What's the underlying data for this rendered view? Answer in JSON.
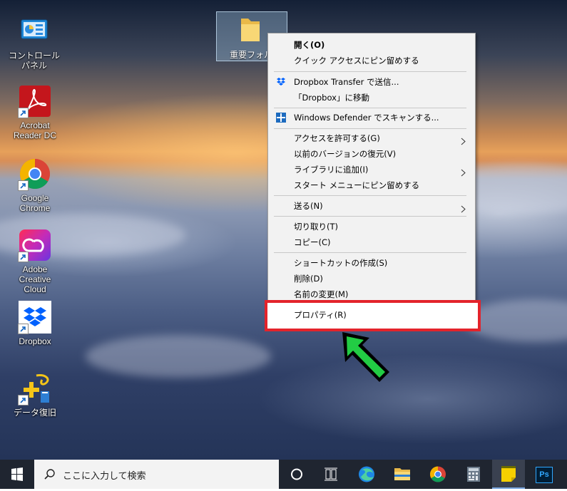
{
  "desktop": {
    "icons": [
      {
        "label": "コントロール パネル",
        "icon": "control-panel-icon"
      },
      {
        "label": "Acrobat Reader DC",
        "icon": "acrobat-reader-icon"
      },
      {
        "label": "Google Chrome",
        "icon": "chrome-icon"
      },
      {
        "label": "Adobe Creative Cloud",
        "icon": "creative-cloud-icon"
      },
      {
        "label": "Dropbox",
        "icon": "dropbox-icon"
      },
      {
        "label": "データ復旧",
        "icon": "data-recovery-icon"
      }
    ],
    "selected_folder": {
      "label": "重要フォルダ",
      "icon": "folder-icon"
    }
  },
  "context_menu": {
    "items": [
      {
        "label": "開く(O)",
        "bold": true
      },
      {
        "label": "クイック アクセスにピン留めする"
      },
      {
        "label": "Dropbox Transfer で送信...",
        "icon": "dropbox-icon"
      },
      {
        "label": "「Dropbox」に移動"
      },
      {
        "label": "Windows Defender でスキャンする...",
        "icon": "defender-icon"
      },
      {
        "label": "アクセスを許可する(G)",
        "submenu": true
      },
      {
        "label": "以前のバージョンの復元(V)"
      },
      {
        "label": "ライブラリに追加(I)",
        "submenu": true
      },
      {
        "label": "スタート メニューにピン留めする"
      },
      {
        "label": "送る(N)",
        "submenu": true
      },
      {
        "label": "切り取り(T)"
      },
      {
        "label": "コピー(C)"
      },
      {
        "label": "ショートカットの作成(S)"
      },
      {
        "label": "削除(D)"
      },
      {
        "label": "名前の変更(M)"
      },
      {
        "label": "プロパティ(R)",
        "highlighted": true
      }
    ]
  },
  "annotation": {
    "highlight_color": "#e3232b",
    "arrow_color": "#22cc44"
  },
  "taskbar": {
    "search_placeholder": "ここに入力して検索",
    "apps": [
      "start-icon",
      "cortana-icon",
      "task-view-icon",
      "edge-icon",
      "file-explorer-icon",
      "chrome-icon",
      "calculator-icon",
      "sticky-notes-icon",
      "photoshop-icon"
    ],
    "photoshop_label": "Ps"
  }
}
